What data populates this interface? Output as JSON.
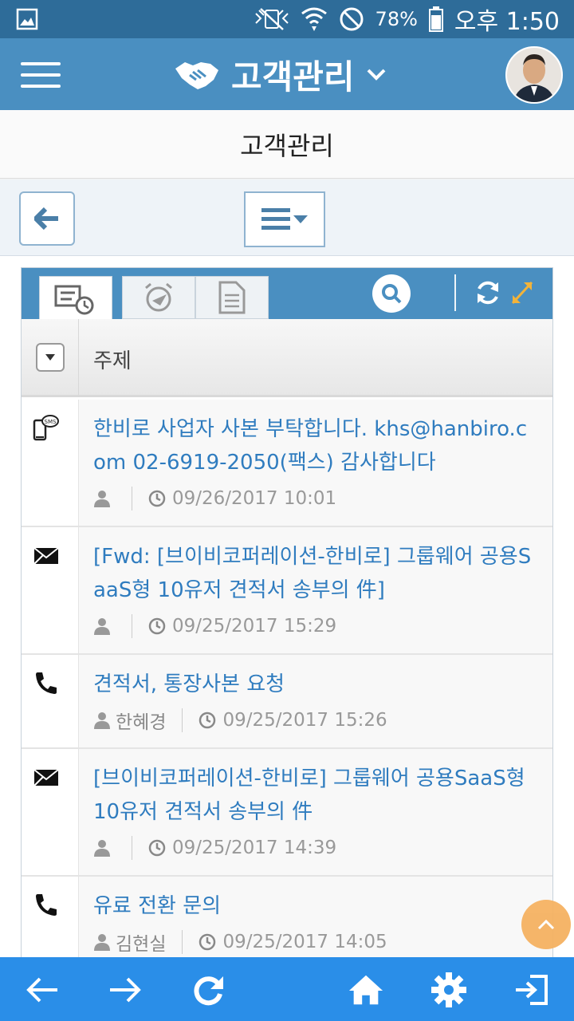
{
  "status_bar": {
    "battery_percent": "78%",
    "time": "오후 1:50"
  },
  "header": {
    "title": "고객관리"
  },
  "page": {
    "title": "고객관리"
  },
  "list": {
    "column_subject": "주제",
    "items": [
      {
        "type": "sms",
        "subject": "한비로 사업자 사본 부탁합니다. khs@hanbiro.com 02-6919-2050(팩스) 감사합니다",
        "user": "",
        "datetime": "09/26/2017 10:01"
      },
      {
        "type": "email",
        "subject": "[Fwd: [브이비코퍼레이션-한비로] 그룹웨어 공용SaaS형 10유저 견적서 송부의 件]",
        "user": "",
        "datetime": "09/25/2017 15:29"
      },
      {
        "type": "phone",
        "subject": "견적서, 통장사본 요청",
        "user": "한혜경",
        "datetime": "09/25/2017 15:26"
      },
      {
        "type": "email",
        "subject": "[브이비코퍼레이션-한비로] 그룹웨어 공용SaaS형 10유저 견적서 송부의 件",
        "user": "",
        "datetime": "09/25/2017 14:39"
      },
      {
        "type": "phone",
        "subject": "유료 전환 문의",
        "user": "김현실",
        "datetime": "09/25/2017 14:05"
      }
    ]
  },
  "colors": {
    "status_bar": "#2e6c99",
    "header": "#4a8fc1",
    "link": "#2f7cbf",
    "bottom_nav": "#2a8ee8",
    "scroll_top": "#f5b262"
  },
  "icons": [
    "image-icon",
    "mute-icon",
    "wifi-icon",
    "blocked-icon",
    "battery-icon",
    "hamburger-icon",
    "handshake-icon",
    "chevron-down-icon",
    "back-arrow-icon",
    "list-menu-icon",
    "history-icon",
    "alarm-icon",
    "document-icon",
    "search-icon",
    "refresh-icon",
    "expand-icon",
    "sms-icon",
    "envelope-icon",
    "phone-icon",
    "user-icon",
    "clock-icon",
    "arrow-up-icon",
    "arrow-left-icon",
    "arrow-right-icon",
    "reload-icon",
    "home-icon",
    "gear-icon",
    "logout-icon"
  ]
}
